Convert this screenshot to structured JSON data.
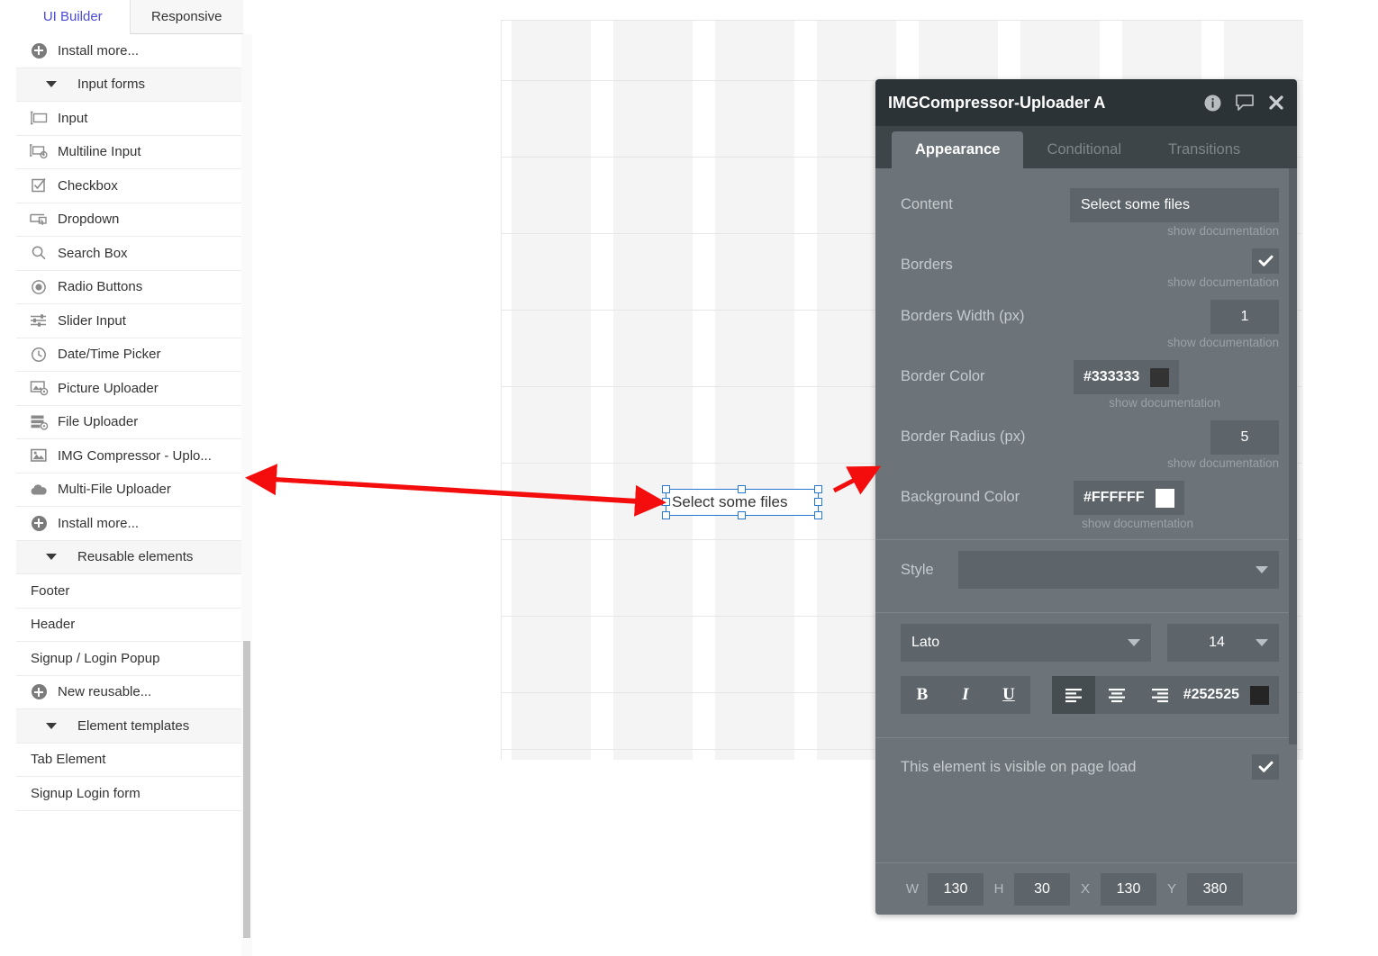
{
  "sidebar": {
    "tabs": [
      {
        "label": "UI Builder",
        "active": true
      },
      {
        "label": "Responsive",
        "active": false
      }
    ],
    "items": [
      {
        "label": "Install more...",
        "icon": "plus-circle-icon",
        "kind": "item"
      },
      {
        "label": "Input forms",
        "icon": "caret-down-icon",
        "kind": "group"
      },
      {
        "label": "Input",
        "icon": "input-icon",
        "kind": "item"
      },
      {
        "label": "Multiline Input",
        "icon": "multiline-input-icon",
        "kind": "item"
      },
      {
        "label": "Checkbox",
        "icon": "checkbox-icon",
        "kind": "item"
      },
      {
        "label": "Dropdown",
        "icon": "dropdown-icon",
        "kind": "item"
      },
      {
        "label": "Search Box",
        "icon": "search-icon",
        "kind": "item"
      },
      {
        "label": "Radio Buttons",
        "icon": "radio-icon",
        "kind": "item"
      },
      {
        "label": "Slider Input",
        "icon": "slider-icon",
        "kind": "item"
      },
      {
        "label": "Date/Time Picker",
        "icon": "clock-icon",
        "kind": "item"
      },
      {
        "label": "Picture Uploader",
        "icon": "picture-uploader-icon",
        "kind": "item"
      },
      {
        "label": "File Uploader",
        "icon": "file-uploader-icon",
        "kind": "item"
      },
      {
        "label": "IMG Compressor - Uplo...",
        "icon": "image-icon",
        "kind": "item"
      },
      {
        "label": "Multi-File Uploader",
        "icon": "cloud-upload-icon",
        "kind": "item"
      },
      {
        "label": "Install more...",
        "icon": "plus-circle-icon",
        "kind": "item"
      },
      {
        "label": "Reusable elements",
        "icon": "caret-down-icon",
        "kind": "group"
      },
      {
        "label": "Footer",
        "icon": "",
        "kind": "plain"
      },
      {
        "label": "Header",
        "icon": "",
        "kind": "plain"
      },
      {
        "label": "Signup / Login Popup",
        "icon": "",
        "kind": "plain"
      },
      {
        "label": "New reusable...",
        "icon": "plus-circle-icon",
        "kind": "item"
      },
      {
        "label": "Element templates",
        "icon": "caret-down-icon",
        "kind": "group"
      },
      {
        "label": "Tab Element",
        "icon": "",
        "kind": "plain"
      },
      {
        "label": "Signup Login form",
        "icon": "",
        "kind": "plain"
      }
    ]
  },
  "canvas": {
    "selected_element": {
      "text": "Select some files"
    }
  },
  "panel": {
    "title": "IMGCompressor-Uploader A",
    "header_icons": [
      "info-icon",
      "comment-icon",
      "close-icon"
    ],
    "tabs": [
      {
        "label": "Appearance",
        "active": true
      },
      {
        "label": "Conditional",
        "active": false
      },
      {
        "label": "Transitions",
        "active": false
      }
    ],
    "doc_link": "show documentation",
    "fields": {
      "content": {
        "label": "Content",
        "value": "Select some files"
      },
      "borders": {
        "label": "Borders",
        "checked": true
      },
      "borders_width": {
        "label": "Borders Width (px)",
        "value": "1"
      },
      "border_color": {
        "label": "Border Color",
        "value": "#333333",
        "swatch": "#333333"
      },
      "border_radius": {
        "label": "Border Radius (px)",
        "value": "5"
      },
      "background_color": {
        "label": "Background Color",
        "value": "#FFFFFF",
        "swatch": "#FFFFFF"
      },
      "style": {
        "label": "Style",
        "value": ""
      },
      "font_family": {
        "value": "Lato"
      },
      "font_size": {
        "value": "14"
      },
      "font_color": {
        "value": "#252525",
        "swatch": "#252525"
      },
      "bold": {
        "label": "B"
      },
      "italic": {
        "label": "I"
      },
      "underline": {
        "label": "U"
      },
      "align_left": {
        "label": "☰",
        "active": true
      },
      "align_center": {
        "label": "☰",
        "active": false
      },
      "align_right": {
        "label": "☰",
        "active": false
      },
      "visible_on_load": {
        "label": "This element is visible on page load",
        "checked": true
      }
    },
    "geometry": [
      {
        "key": "W",
        "value": "130"
      },
      {
        "key": "H",
        "value": "30"
      },
      {
        "key": "X",
        "value": "130"
      },
      {
        "key": "Y",
        "value": "380"
      }
    ]
  },
  "annotations": {
    "arrow_color": "#f40d0d"
  }
}
